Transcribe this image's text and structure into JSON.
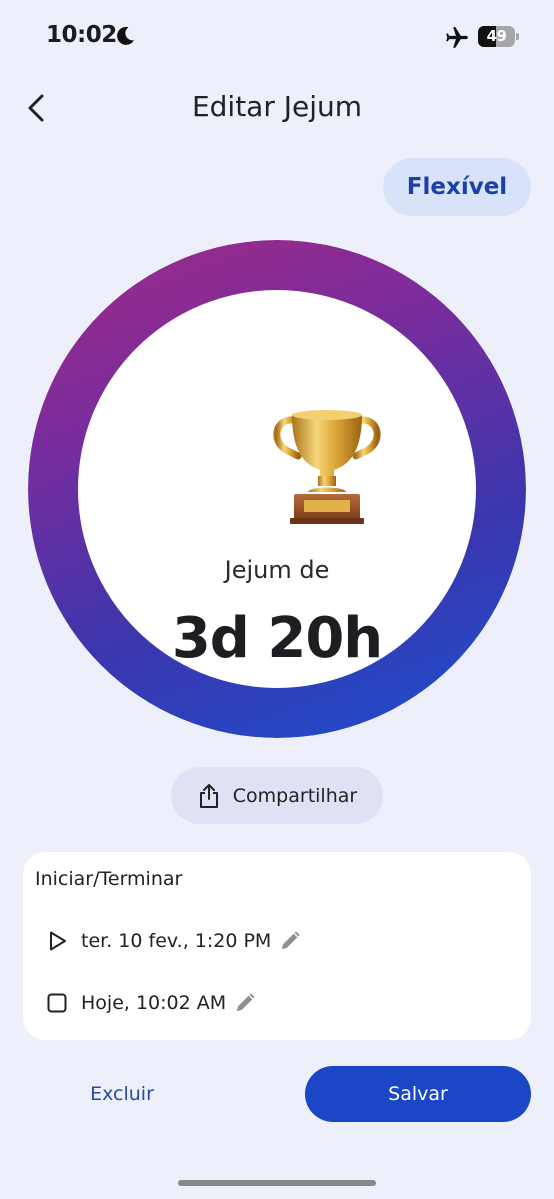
{
  "status_bar": {
    "time": "10:02",
    "battery": "49",
    "battery_level": 0.49,
    "icons": [
      "moon-icon",
      "airplane-icon",
      "battery-icon"
    ]
  },
  "nav": {
    "title": "Editar Jejum",
    "back_icon": "chevron-left-icon"
  },
  "mode_label": "Flexível",
  "ring": {
    "label": "Jejum de",
    "value": "3d 20h",
    "trophy_icon": "trophy-icon",
    "progress": 1.0,
    "gradient_colors": [
      "#a02a86",
      "#7b2c9c",
      "#3b36ad",
      "#1b4fd0"
    ]
  },
  "share": {
    "label": "Compartilhar",
    "icon": "share-icon"
  },
  "times_card": {
    "title": "Iniciar/Terminar",
    "start": {
      "text": "ter. 10 fev., 1:20 PM",
      "icon": "play-icon"
    },
    "end": {
      "text": "Hoje, 10:02 AM",
      "icon": "stop-square-icon"
    },
    "edit_icon": "pencil-icon"
  },
  "actions": {
    "delete_label": "Excluir",
    "save_label": "Salvar"
  },
  "colors": {
    "background": "#edf0fb",
    "accent": "#1b47c6",
    "pill_bg": "#d8e2f8",
    "pill_text": "#1d3fa8",
    "share_bg": "#dfe2f4"
  }
}
